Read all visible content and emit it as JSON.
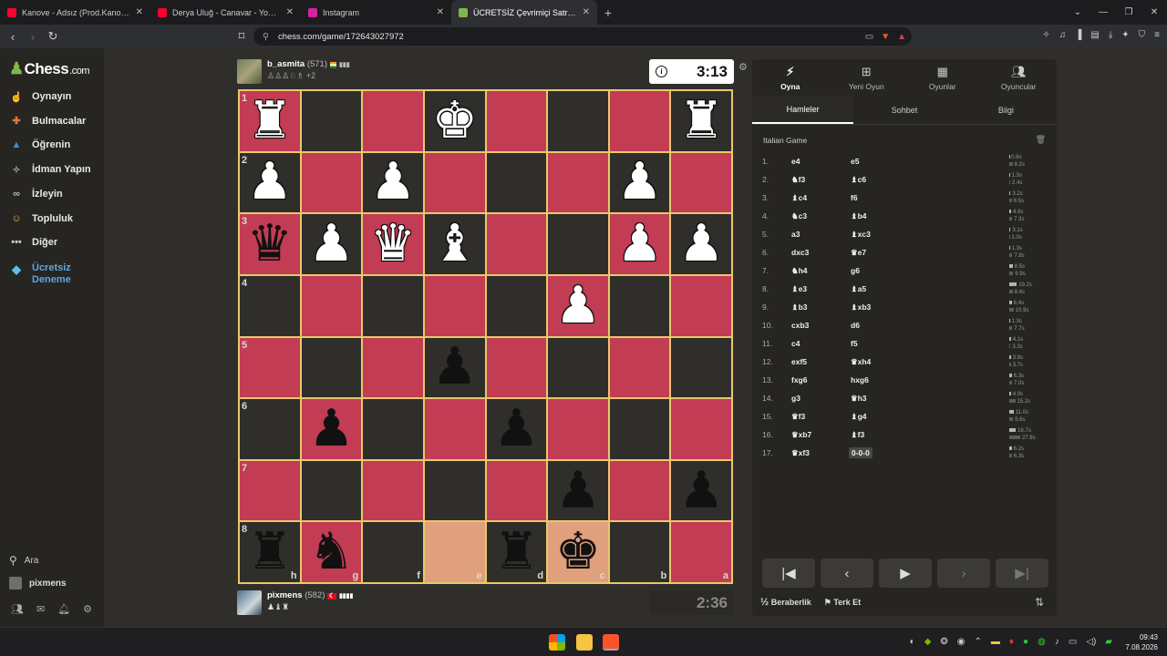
{
  "browser": {
    "tabs": [
      {
        "title": "Kanove - Adsız (Prod.Kanove) - YouTu",
        "color": "#ff0033",
        "active": false
      },
      {
        "title": "Derya Uluğ - Canavar - YouTube",
        "color": "#ff0033",
        "active": false
      },
      {
        "title": "Instagram",
        "color": "#d6249f",
        "active": false
      },
      {
        "title": "ÜCRETSİZ Çevrimiçi Satranç Oyna",
        "color": "#81b64c",
        "active": true
      }
    ],
    "url": "chess.com/game/172643027972"
  },
  "sidebar": {
    "logo": "Chess",
    "logo_suffix": ".com",
    "items": [
      {
        "label": "Oynayın",
        "icon": "play-hand-icon",
        "color": "#e6a23c"
      },
      {
        "label": "Bulmacalar",
        "icon": "puzzle-icon",
        "color": "#e0783a"
      },
      {
        "label": "Öğrenin",
        "icon": "graduation-cap-icon",
        "color": "#3b8fd6"
      },
      {
        "label": "İdman Yapın",
        "icon": "target-icon",
        "color": "#a0a0a0"
      },
      {
        "label": "İzleyin",
        "icon": "binoculars-icon",
        "color": "#b9b9b9"
      },
      {
        "label": "Topluluk",
        "icon": "community-icon",
        "color": "#e8b04a"
      },
      {
        "label": "Diğer",
        "icon": "more-icon",
        "color": "#cccccc"
      }
    ],
    "trial_line1": "Ücretsiz",
    "trial_line2": "Deneme",
    "search_label": "Ara",
    "user_label": "pixmens"
  },
  "top_player": {
    "name": "b_asmita",
    "rating": "(571)",
    "captured": "+2",
    "clock": "3:13"
  },
  "bottom_player": {
    "name": "pixmens",
    "rating": "(582)",
    "clock": "2:36"
  },
  "board": {
    "ranks": [
      "1",
      "2",
      "3",
      "4",
      "5",
      "6",
      "7",
      "8"
    ],
    "files": [
      "h",
      "g",
      "f",
      "e",
      "d",
      "c",
      "b",
      "a"
    ],
    "squares": [
      [
        "l:wR",
        "d:",
        "l:",
        "d:wK",
        "l:",
        "d:",
        "l:",
        "d:wR"
      ],
      [
        "d:wP",
        "l:",
        "d:wP",
        "l:",
        "d:",
        "l:",
        "d:wP",
        "l:"
      ],
      [
        "l:bQ",
        "d:wP",
        "l:wQ",
        "d:wB",
        "l:",
        "d:",
        "l:wP",
        "d:wP"
      ],
      [
        "d:",
        "l:",
        "d:",
        "l:",
        "d:",
        "l:wP",
        "d:",
        "l:"
      ],
      [
        "l:",
        "d:",
        "l:",
        "d:bP",
        "l:",
        "d:",
        "l:",
        "d:"
      ],
      [
        "d:",
        "l:bP",
        "d:",
        "l:",
        "d:bP",
        "l:",
        "d:",
        "l:"
      ],
      [
        "l:",
        "d:",
        "l:",
        "d:",
        "l:",
        "d:bP",
        "l:",
        "d:bP"
      ],
      [
        "d:bR",
        "l:bN",
        "d:",
        "h:",
        "d:bR",
        "h:bK",
        "d:",
        "l:"
      ]
    ]
  },
  "panel": {
    "tabs": [
      {
        "label": "Oyna",
        "icon": "lightning-icon",
        "active": true
      },
      {
        "label": "Yeni Oyun",
        "icon": "plus-square-icon",
        "active": false
      },
      {
        "label": "Oyunlar",
        "icon": "chessboard-icon",
        "active": false
      },
      {
        "label": "Oyuncular",
        "icon": "players-icon",
        "active": false
      }
    ],
    "subtabs": [
      {
        "label": "Hamleler",
        "active": true
      },
      {
        "label": "Sohbet",
        "active": false
      },
      {
        "label": "Bilgi",
        "active": false
      }
    ],
    "opening": "Italian Game",
    "moves": [
      {
        "n": "1.",
        "w": "e4",
        "b": "e5",
        "wt": "0.6s",
        "bt": "8.2s"
      },
      {
        "n": "2.",
        "w": "♞f3",
        "b": "♝c6",
        "wt": "1.3s",
        "bt": "2.4s"
      },
      {
        "n": "3.",
        "w": "♝c4",
        "b": "f6",
        "wt": "3.2s",
        "bt": "6.5s"
      },
      {
        "n": "4.",
        "w": "♞c3",
        "b": "♝b4",
        "wt": "4.8s",
        "bt": "7.3s"
      },
      {
        "n": "5.",
        "w": "a3",
        "b": "♝xc3",
        "wt": "3.1s",
        "bt": "1.0s"
      },
      {
        "n": "6.",
        "w": "dxc3",
        "b": "♛e7",
        "wt": "1.3s",
        "bt": "7.8s"
      },
      {
        "n": "7.",
        "w": "♞h4",
        "b": "g6",
        "wt": "8.5s",
        "bt": "9.9s"
      },
      {
        "n": "8.",
        "w": "♝e3",
        "b": "♝a5",
        "wt": "19.2s",
        "bt": "8.4s"
      },
      {
        "n": "9.",
        "w": "♝b3",
        "b": "♝xb3",
        "wt": "6.4s",
        "bt": "10.9s"
      },
      {
        "n": "10.",
        "w": "cxb3",
        "b": "d6",
        "wt": "1.3s",
        "bt": "7.7s"
      },
      {
        "n": "11.",
        "w": "c4",
        "b": "f5",
        "wt": "4.1s",
        "bt": "3.3s"
      },
      {
        "n": "12.",
        "w": "exf5",
        "b": "♛xh4",
        "wt": "3.9s",
        "bt": "3.7s"
      },
      {
        "n": "13.",
        "w": "fxg6",
        "b": "hxg6",
        "wt": "6.3s",
        "bt": "7.0s"
      },
      {
        "n": "14.",
        "w": "g3",
        "b": "♛h3",
        "wt": "4.0s",
        "bt": "15.2s"
      },
      {
        "n": "15.",
        "w": "♛f3",
        "b": "♝g4",
        "wt": "11.0s",
        "bt": "9.6s"
      },
      {
        "n": "16.",
        "w": "♛xb7",
        "b": "♝f3",
        "wt": "16.7s",
        "bt": "27.9s"
      },
      {
        "n": "17.",
        "w": "♛xf3",
        "b": "0-0-0",
        "wt": "6.2s",
        "bt": "6.3s"
      }
    ],
    "draw_label": "Beraberlik",
    "draw_icon_text": "½",
    "resign_label": "Terk Et"
  },
  "taskbar": {
    "time": "09:43",
    "date": "7.08.2026"
  }
}
